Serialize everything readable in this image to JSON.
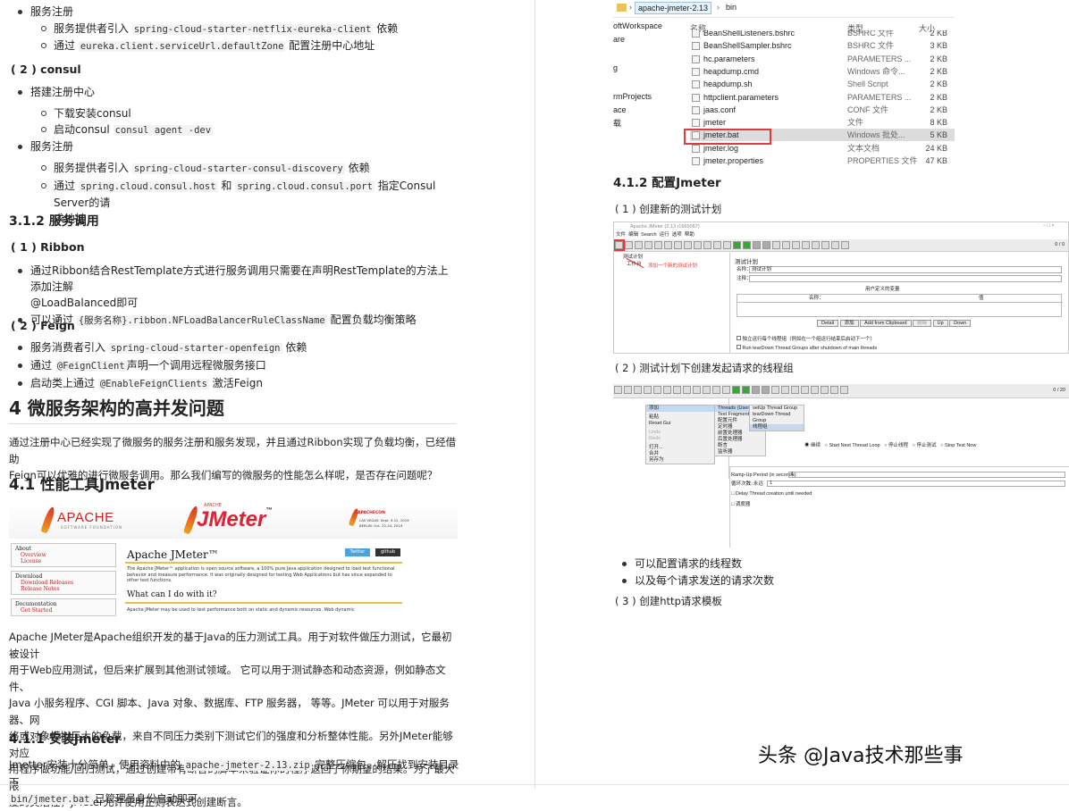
{
  "left": {
    "reg1": {
      "title": "服务注册",
      "item1_pre": "服务提供者引入",
      "item1_code": "spring-cloud-starter-netflix-eureka-client",
      "item1_post": "依赖",
      "item2_pre": "通过",
      "item2_code": "eureka.client.serviceUrl.defaultZone",
      "item2_post": "配置注册中心地址"
    },
    "consul": {
      "heading": "( 2 ) consul",
      "build": "搭建注册中心",
      "dl": "下载安装consul",
      "start_pre": "启动consul",
      "start_code": "consul agent -dev",
      "reg": "服务注册",
      "p1_pre": "服务提供者引入",
      "p1_code": "spring-cloud-starter-consul-discovery",
      "p1_post": "依赖",
      "p2_pre": "通过",
      "p2_code1": "spring.cloud.consul.host",
      "p2_mid": "和",
      "p2_code2": "spring.cloud.consul.port",
      "p2_post": "指定Consul Server的请",
      "p2_post2": "求地址"
    },
    "call": {
      "heading": "3.1.2 服务调用",
      "ribbon": "( 1 ) Ribbon",
      "r1": "通过Ribbon结合RestTemplate方式进行服务调用只需要在声明RestTemplate的方法上添加注解",
      "r1b": "@LoadBalanced即可",
      "r2_pre": "可以通过",
      "r2_code": "{服务名称}.ribbon.NFLoadBalancerRuleClassName",
      "r2_post": "配置负载均衡策略",
      "feign": "( 2 ) Feign",
      "f1_pre": "服务消费者引入",
      "f1_code": "spring-cloud-starter-openfeign",
      "f1_post": "依赖",
      "f2_pre": "通过",
      "f2_code": "@FeignClient",
      "f2_post": "声明一个调用远程微服务接口",
      "f3_pre": "启动类上通过",
      "f3_code": "@EnableFeignClients",
      "f3_post": "激活Feign"
    },
    "sec4": {
      "heading": "4 微服务架构的高并发问题",
      "para1": "通过注册中心已经实现了微服务的服务注册和服务发现，并且通过Ribbon实现了负载均衡，已经借助",
      "para2": "Feign可以优雅的进行微服务调用。那么我们编写的微服务的性能怎么样呢，是否存在问题呢？"
    },
    "jmeter": {
      "heading": "4.1 性能工具Jmeter",
      "banner": {
        "apache": "APACHE",
        "apache_sub": "SOFTWARE FOUNDATION",
        "jm_small": "APACHE",
        "jm_big": "JMeter",
        "tm": "™",
        "con_logo": "APACHECON",
        "con1": "LAS VEGAS: Sept. 9-12, 2019",
        "con2": "BERLIN: Oct. 22-24, 2019",
        "about": "About",
        "overview": "Overview",
        "license": "License",
        "download": "Download",
        "dl_rel": "Download Releases",
        "rel_notes": "Release Notes",
        "docs": "Documentation",
        "started": "Get Started",
        "page_title": "Apache JMeter™",
        "twitter": "Twitter",
        "github": "github",
        "desc": "The Apache JMeter™ application is open source software, a 100% pure Java application designed to load test functional behavior and measure performance. It was originally designed for testing Web Applications but has since expanded to other test functions.",
        "what": "What can I do with it?",
        "desc2": "Apache JMeter may be used to test performance both on static and dynamic resources, Web dynamic"
      },
      "p1": "Apache JMeter是Apache组织开发的基于Java的压力测试工具。用于对软件做压力测试，它最初被设计",
      "p2": "用于Web应用测试，但后来扩展到其他测试领域。 它可以用于测试静态和动态资源，例如静态文件、",
      "p3": "Java 小服务程序、CGI 脚本、Java 对象、数据库、FTP 服务器， 等等。JMeter 可以用于对服务器、网",
      "p4": "络或对象模拟巨大的负载，来自不同压力类别下测试它们的强度和分析整体性能。另外JMeter能够对应",
      "p5": "用程序做功能/回归测试，通过创建带有断言的脚本来验证你的程序返回了你期望的结果。为了最大限",
      "p6": "度的灵活性，JMeter允许使用正则表达式创建断言。"
    },
    "install": {
      "heading": "4.1.1 安装Jmeter",
      "t1_pre": "Jmetter安装十分简单，使用资料中的",
      "t1_code": "apache-jmeter-2.13.zip",
      "t1_post": "完整压缩包，解压找到安装目录下",
      "t2_code": "bin/jmeter.bat",
      "t2_post": "已管理员身份启动即可"
    }
  },
  "right": {
    "explorer": {
      "crumb1": "apache-jmeter-2.13",
      "crumb2": "bin",
      "col_name": "名称",
      "col_type": "类型",
      "col_size": "大小",
      "side": [
        "oftWorkspace",
        "are",
        "g",
        "rmProjects",
        "ace",
        "载"
      ],
      "files": [
        {
          "name": "BeanShellListeners.bshrc",
          "type": "BSHRC 文件",
          "size": "2 KB"
        },
        {
          "name": "BeanShellSampler.bshrc",
          "type": "BSHRC 文件",
          "size": "3 KB"
        },
        {
          "name": "hc.parameters",
          "type": "PARAMETERS ...",
          "size": "2 KB"
        },
        {
          "name": "heapdump.cmd",
          "type": "Windows 命令...",
          "size": "2 KB"
        },
        {
          "name": "heapdump.sh",
          "type": "Shell Script",
          "size": "2 KB"
        },
        {
          "name": "httpclient.parameters",
          "type": "PARAMETERS ...",
          "size": "2 KB"
        },
        {
          "name": "jaas.conf",
          "type": "CONF 文件",
          "size": "2 KB"
        },
        {
          "name": "jmeter",
          "type": "文件",
          "size": "8 KB"
        },
        {
          "name": "jmeter.bat",
          "type": "Windows 批处...",
          "size": "5 KB"
        },
        {
          "name": "jmeter.log",
          "type": "文本文档",
          "size": "24 KB"
        },
        {
          "name": "jmeter.properties",
          "type": "PROPERTIES 文件",
          "size": "47 KB"
        }
      ]
    },
    "config": {
      "heading": "4.1.2 配置Jmeter",
      "s1": "( 1 ) 创建新的测试计划",
      "ss1": {
        "title": "Apache JMeter (2.13 r1665067)",
        "menu": [
          "文件",
          "编辑",
          "Search",
          "运行",
          "选项",
          "帮助"
        ],
        "tree1": "测试计划",
        "tree2": "工作台",
        "note": "添加一个新的测试计划",
        "plan": "测试计划",
        "name_label": "名称：",
        "name_value": "测试计划",
        "comment_label": "注释：",
        "vars": "用户定义的变量",
        "col_name": "名称：",
        "col_value": "值",
        "btns": [
          "Detail",
          "添加",
          "Add from Clipboard",
          "删除",
          "Up",
          "Down"
        ],
        "opt1": "独立运行每个线程组（例如在一个组运行结束后启动下一个）",
        "opt2": "Run tearDown Thread Groups after shutdown of main threads",
        "counter": "0 / 0"
      },
      "s2": "( 2 ) 测试计划下创建发起请求的线程组",
      "ss2": {
        "menu1": [
          "添加",
          "粘贴",
          "Reset Gui",
          "Undo",
          "Redo",
          "打开...",
          "合并",
          "另存为"
        ],
        "menu2": [
          "Threads (Users)",
          "Test Fragment",
          "配置元件",
          "定时器",
          "前置处理器",
          "后置处理器",
          "断言",
          "监听器"
        ],
        "menu3": [
          "setUp Thread Group",
          "tearDown Thread Group",
          "线程组"
        ],
        "radios": [
          "继续",
          "Start Next Thread Loop",
          "停止线程",
          "停止测试",
          "Stop Test Now"
        ],
        "ramp": "Ramp-Up Period (in seconds):",
        "ramp_v": "1",
        "loop": "循环次数",
        "forever": "永远",
        "loop_v": "1",
        "delay": "Delay Thread creation until needed",
        "sched": "调度器",
        "counter": "0 / 20"
      },
      "b1": "可以配置请求的线程数",
      "b2": "以及每个请求发送的请求次数",
      "s3": "( 3 ) 创建http请求模板"
    },
    "watermark": "头条 @Java技术那些事"
  }
}
